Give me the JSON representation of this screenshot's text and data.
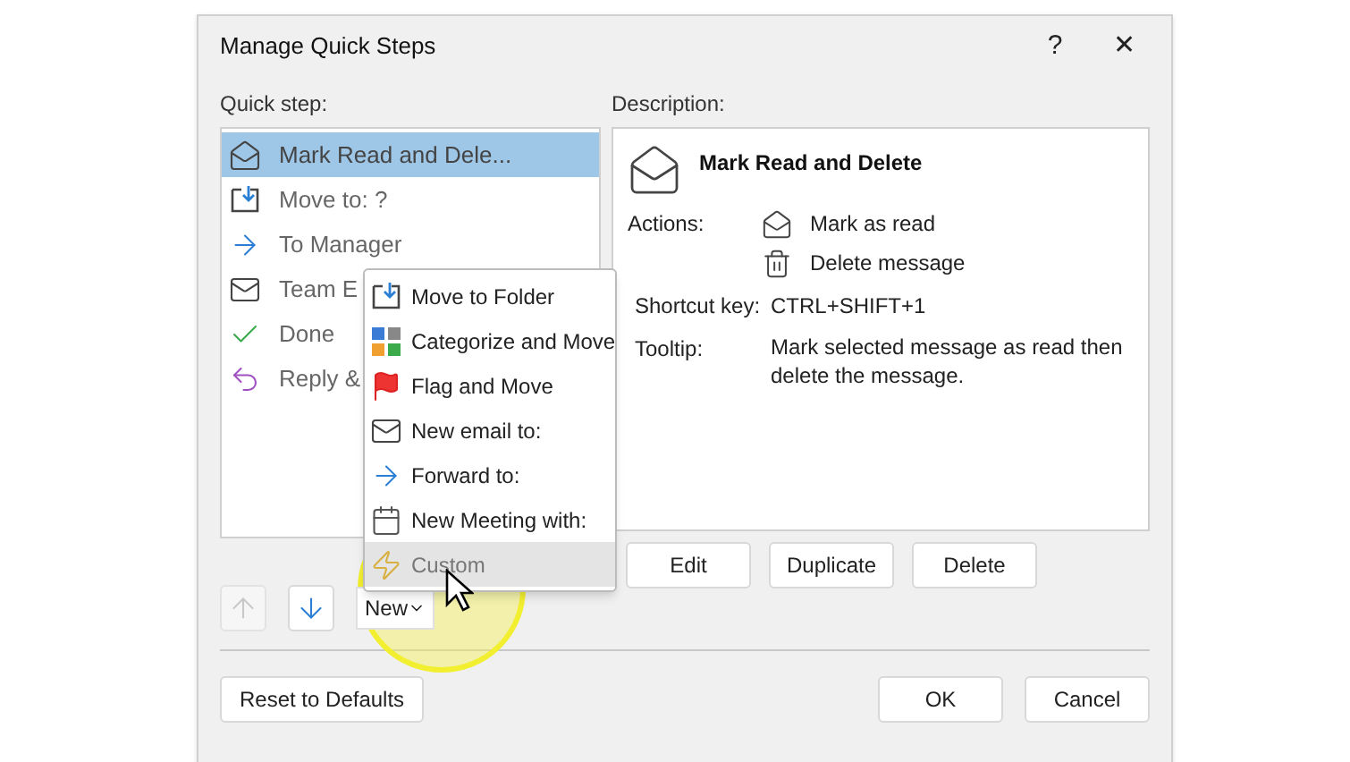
{
  "dialog": {
    "title": "Manage Quick Steps",
    "help_button": "?",
    "close_button": "✕"
  },
  "quick_steps": {
    "label": "Quick step:",
    "items": [
      {
        "kind": "envelope-open",
        "label": "Mark Read and Dele...",
        "selected": true
      },
      {
        "kind": "move",
        "label": "Move to: ?",
        "selected": false
      },
      {
        "kind": "arrow",
        "label": "To Manager",
        "selected": false
      },
      {
        "kind": "envelope",
        "label": "Team E",
        "selected": false
      },
      {
        "kind": "check",
        "label": "Done",
        "selected": false
      },
      {
        "kind": "reply",
        "label": "Reply &",
        "selected": false
      }
    ]
  },
  "description": {
    "label": "Description:",
    "title": "Mark Read and Delete",
    "actions_label": "Actions:",
    "actions": [
      {
        "kind": "envelope-open",
        "label": "Mark as read"
      },
      {
        "kind": "trash",
        "label": "Delete message"
      }
    ],
    "shortcut_label": "Shortcut key:",
    "shortcut": "CTRL+SHIFT+1",
    "tooltip_label": "Tooltip:",
    "tooltip": "Mark selected message as read then delete the message."
  },
  "edit_buttons": [
    "Edit",
    "Duplicate",
    "Delete"
  ],
  "arrows": [
    {
      "kind": "up",
      "disabled": true
    },
    {
      "kind": "down",
      "disabled": false
    }
  ],
  "new_button": "New",
  "new_menu": [
    {
      "kind": "move",
      "label": "Move to Folder",
      "selected": false
    },
    {
      "kind": "categorize",
      "label": "Categorize and Move",
      "selected": false
    },
    {
      "kind": "flag",
      "label": "Flag and Move",
      "selected": false
    },
    {
      "kind": "envelope",
      "label": "New email to:",
      "selected": false
    },
    {
      "kind": "arrow",
      "label": "Forward to:",
      "selected": false
    },
    {
      "kind": "meeting",
      "label": "New Meeting with:",
      "selected": false
    },
    {
      "kind": "custom",
      "label": "Custom",
      "selected": true
    }
  ],
  "footer": {
    "reset": "Reset to Defaults",
    "ok": "OK",
    "cancel": "Cancel"
  }
}
